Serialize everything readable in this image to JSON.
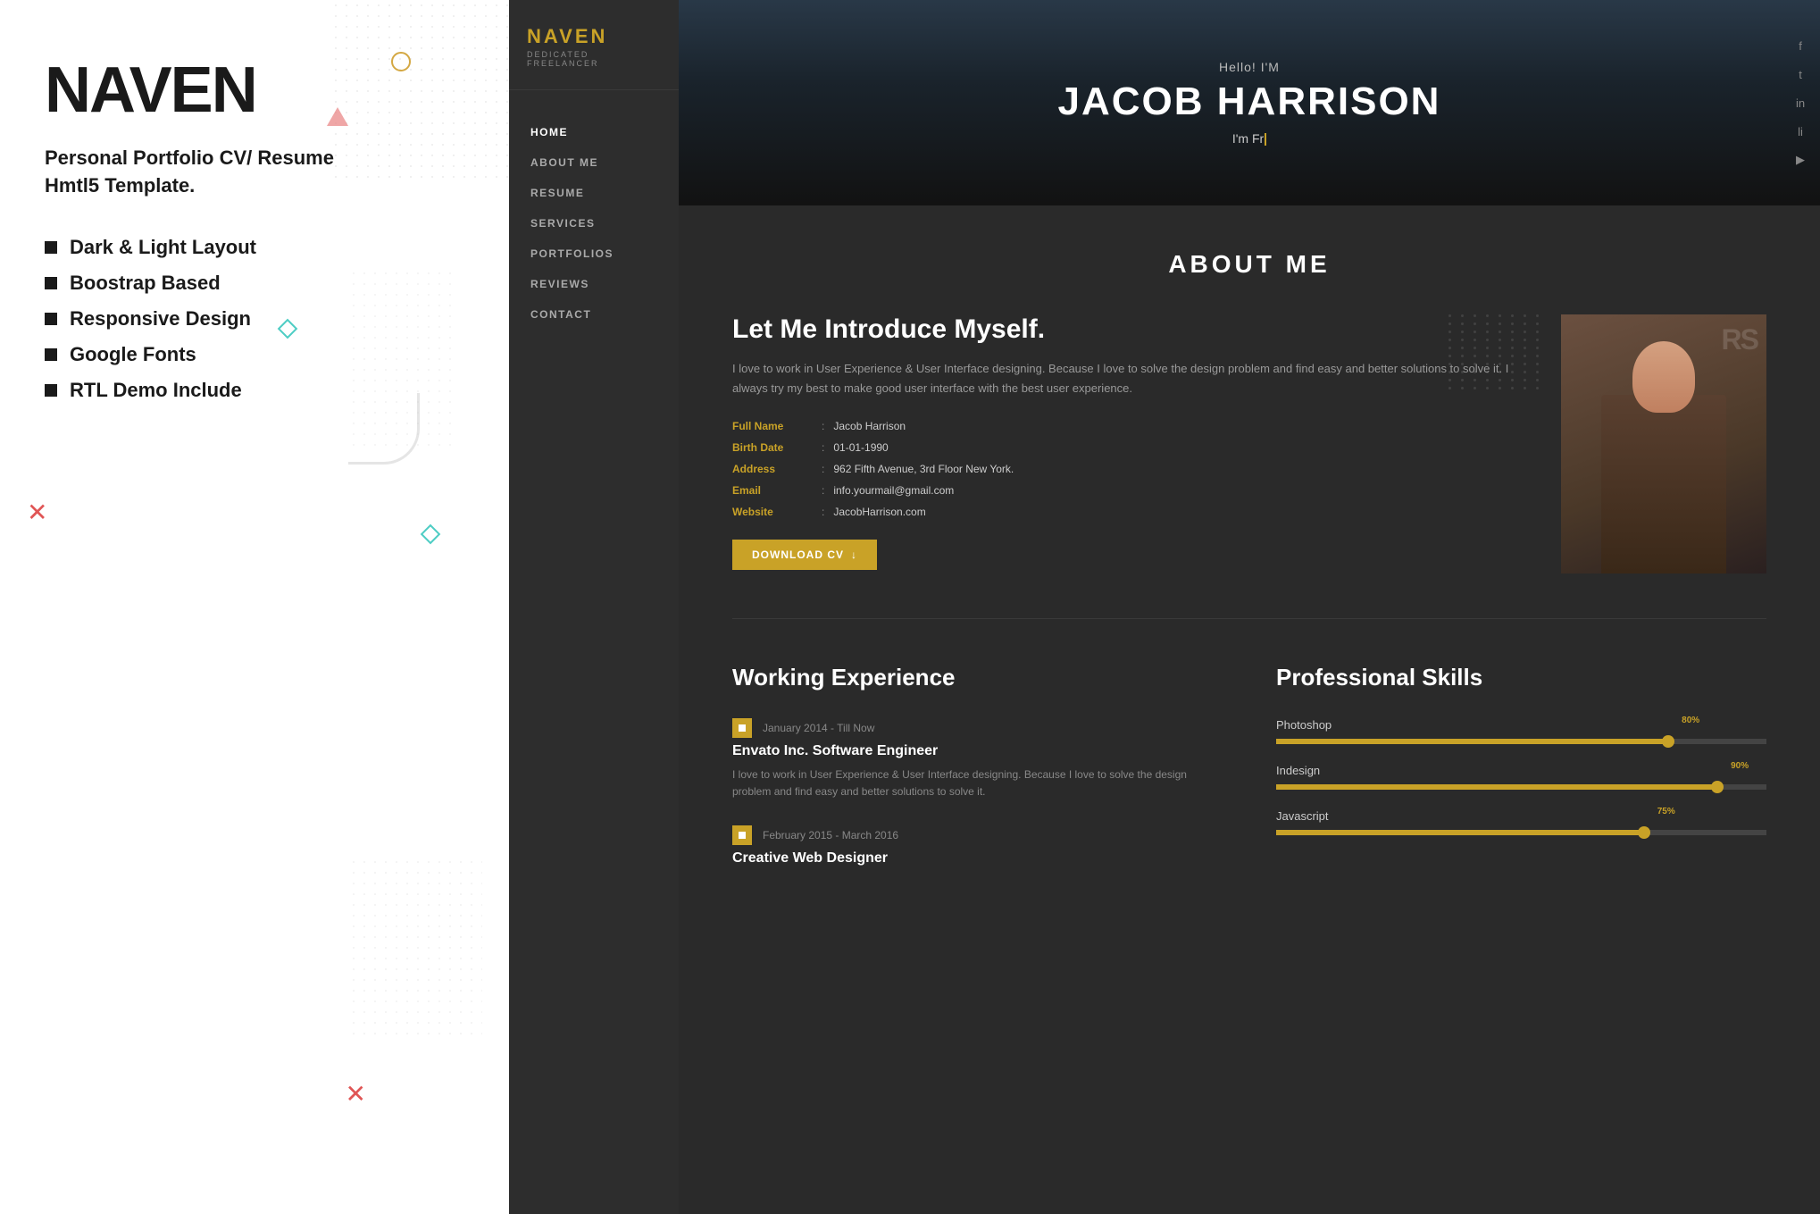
{
  "left": {
    "brand": "NAVEN",
    "subtitle": "Personal Portfolio CV/ Resume\nHmtl5 Template.",
    "features": [
      "Dark & Light Layout",
      "Boostrap Based",
      "Responsive Design",
      "Google Fonts",
      "RTL Demo Include"
    ]
  },
  "sidebar": {
    "logo_title": "NAVEN",
    "logo_sub": "DEDICATED FREELANCER",
    "nav_items": [
      {
        "label": "HOME",
        "active": true
      },
      {
        "label": "ABOUT ME",
        "active": false
      },
      {
        "label": "RESUME",
        "active": false
      },
      {
        "label": "SERVICES",
        "active": false
      },
      {
        "label": "PORTFOLIOS",
        "active": false
      },
      {
        "label": "REVIEWS",
        "active": false
      },
      {
        "label": "CONTACT",
        "active": false
      }
    ]
  },
  "hero": {
    "hello": "Hello! I'M",
    "name": "JACOB HARRISON",
    "role_prefix": "I'm Fr"
  },
  "social": {
    "icons": [
      "f",
      "t",
      "in",
      "li",
      "yt"
    ]
  },
  "about": {
    "section_label": "ABOUT ME",
    "intro_title": "Let Me Introduce Myself.",
    "intro_text": "I love to work in User Experience & User Interface designing. Because I love to solve the design problem and find easy and better solutions to solve it. I always try my best to make good user interface with the best user experience.",
    "info": [
      {
        "label": "Full Name",
        "value": "Jacob Harrison"
      },
      {
        "label": "Birth Date",
        "value": "01-01-1990"
      },
      {
        "label": "Address",
        "value": "962 Fifth Avenue, 3rd Floor New York."
      },
      {
        "label": "Email",
        "value": "info.yourmail@gmail.com"
      },
      {
        "label": "Website",
        "value": "JacobHarrison.com"
      }
    ],
    "download_btn": "DOWNLOAD CV"
  },
  "experience": {
    "title": "Working Experience",
    "items": [
      {
        "date": "January 2014 - Till Now",
        "job_title": "Envato Inc. Software Engineer",
        "desc": "I love to work in User Experience & User Interface designing. Because I love to solve the design problem and find easy and better solutions to solve it."
      },
      {
        "date": "February 2015 - March 2016",
        "job_title": "Creative Web Designer",
        "desc": ""
      }
    ]
  },
  "skills": {
    "title": "Professional Skills",
    "items": [
      {
        "label": "Photoshop",
        "pct": 80
      },
      {
        "label": "Indesign",
        "pct": 90
      },
      {
        "label": "Javascript",
        "pct": 75
      }
    ]
  },
  "colors": {
    "accent": "#c9a227",
    "bg_dark": "#2a2a2a",
    "text_muted": "#888888"
  }
}
